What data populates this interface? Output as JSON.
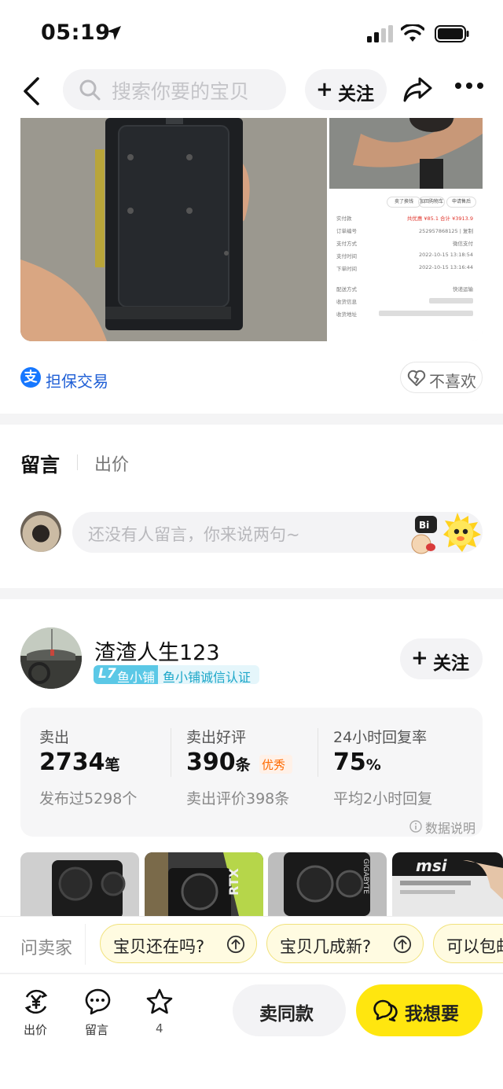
{
  "status_bar": {
    "time": "05:19"
  },
  "nav": {
    "search_placeholder": "搜索你要的宝贝",
    "follow_label": "关注"
  },
  "gallery": {
    "receipt": {
      "buttons": [
        "卖了换钱",
        "加回购物车",
        "申请售后"
      ],
      "rows": [
        {
          "k": "实付款",
          "v": "共优惠 ¥85.1  合计 ¥3913.9"
        },
        {
          "k": "订单编号",
          "v": "2529578681​25 | 复制"
        },
        {
          "k": "支付方式",
          "v": "微信支付"
        },
        {
          "k": "支付时间",
          "v": "2022-10-15 13:18:54"
        },
        {
          "k": "下单时间",
          "v": "2022-10-15 13:16:44"
        },
        {
          "k": "配送方式",
          "v": "快递运输"
        },
        {
          "k": "收货信息",
          "v": ""
        },
        {
          "k": "收货地址",
          "v": ""
        }
      ]
    }
  },
  "guarantee": {
    "icon_char": "支",
    "label": "担保交易"
  },
  "dislike": {
    "label": "不喜欢"
  },
  "comments": {
    "tab_message": "留言",
    "tab_bid": "出价",
    "placeholder": "还没有人留言，你来说两句~"
  },
  "seller": {
    "name": "渣渣人生123",
    "level": "L7",
    "level_name": "鱼小铺",
    "certification": "鱼小铺诚信认证",
    "follow_label": "关注",
    "stats": [
      {
        "label": "卖出",
        "value": "2734",
        "unit": "笔",
        "sub": "发布过5298个"
      },
      {
        "label": "卖出好评",
        "value": "390",
        "unit": "条",
        "badge": "优秀",
        "sub": "卖出评价398条"
      },
      {
        "label": "24小时回复率",
        "value": "75",
        "unit": "%",
        "sub": "平均2小时回复"
      }
    ],
    "data_explain": "数据说明",
    "thumb_labels": [
      "RTX",
      "GIGABYTE",
      "msi"
    ]
  },
  "quick_questions": {
    "label": "问卖家",
    "chips": [
      "宝贝还在吗?",
      "宝贝几成新?",
      "可以包邮吗?"
    ]
  },
  "bottom_bar": {
    "bid_label": "出价",
    "message_label": "留言",
    "favorite_count": "4",
    "sell_same_label": "卖同款",
    "want_label": "我想要"
  },
  "colors": {
    "accent_yellow": "#ffe60f",
    "guarantee_blue": "#1677ff",
    "badge_cyan": "#5bc8e6",
    "excellent_orange": "#ff6a00"
  }
}
